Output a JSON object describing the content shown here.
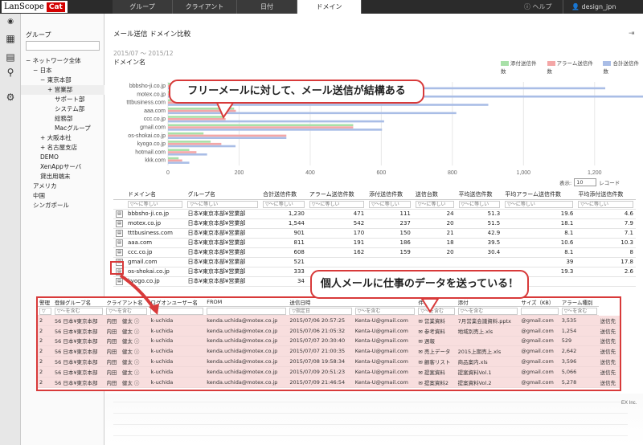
{
  "app": {
    "logo_text": "LanScope",
    "logo_badge": "Cat"
  },
  "tabs": [
    {
      "label": "グループ"
    },
    {
      "label": "クライアント"
    },
    {
      "label": "日付"
    },
    {
      "label": "ドメイン"
    }
  ],
  "header": {
    "help": "ヘルプ",
    "user": "design_jpn"
  },
  "sidebar": {
    "group_label": "グループ",
    "tree": [
      {
        "label": "ネットワーク全体",
        "prefix": "−",
        "indent": 0
      },
      {
        "label": "日本",
        "prefix": "−",
        "indent": 1
      },
      {
        "label": "東京本部",
        "prefix": "−",
        "indent": 2
      },
      {
        "label": "営業部",
        "prefix": "+",
        "indent": 3
      },
      {
        "label": "サポート部",
        "prefix": "",
        "indent": 4
      },
      {
        "label": "システム部",
        "prefix": "",
        "indent": 4
      },
      {
        "label": "総務部",
        "prefix": "",
        "indent": 4
      },
      {
        "label": "Macグループ",
        "prefix": "",
        "indent": 4
      },
      {
        "label": "大阪本社",
        "prefix": "+",
        "indent": 2
      },
      {
        "label": "名古屋支店",
        "prefix": "+",
        "indent": 2
      },
      {
        "label": "DEMO",
        "prefix": "",
        "indent": 2
      },
      {
        "label": "XenAppサーバ",
        "prefix": "",
        "indent": 2
      },
      {
        "label": "貸出用端末",
        "prefix": "",
        "indent": 2
      },
      {
        "label": "アメリカ",
        "prefix": "",
        "indent": 1
      },
      {
        "label": "中国",
        "prefix": "",
        "indent": 1
      },
      {
        "label": "シンガポール",
        "prefix": "",
        "indent": 1
      }
    ]
  },
  "main": {
    "title": "メール送信 ドメイン比較",
    "daterange": "2015/07 〜 2015/12",
    "domain_label": "ドメイン名",
    "pager_label": "表示:",
    "pager_value": "10",
    "pager_unit": "レコード"
  },
  "colors": {
    "attach": "#a8e0a8",
    "alarm": "#f4a7a7",
    "total": "#a9bde6",
    "callout": "#d83a3a"
  },
  "chart_data": {
    "type": "bar",
    "orientation": "horizontal",
    "categories": [
      "bbbsho-ji.co.jp",
      "motex.co.jp",
      "tttbusiness.com",
      "aaa.com",
      "ccc.co.jp",
      "gmail.com",
      "os-shokai.co.jp",
      "kyogo.co.jp",
      "hotmail.com",
      "kkk.com"
    ],
    "series": [
      {
        "name": "添付送信件数",
        "color": "#a8e0a8",
        "values": [
          111,
          237,
          150,
          186,
          159,
          521,
          100,
          120,
          60,
          30
        ]
      },
      {
        "name": "アラーム送信件数",
        "color": "#f4a7a7",
        "values": [
          471,
          542,
          170,
          191,
          162,
          521,
          333,
          150,
          80,
          40
        ]
      },
      {
        "name": "合計送信件数",
        "color": "#a9bde6",
        "values": [
          1230,
          1544,
          901,
          811,
          608,
          602,
          333,
          190,
          110,
          60
        ]
      }
    ],
    "xticks": [
      "0",
      "200",
      "400",
      "600",
      "800",
      "1,000",
      "1,200"
    ],
    "xlim": [
      0,
      1300
    ],
    "legend": "top-right"
  },
  "callouts": {
    "top": "フリーメールに対して、メール送信が結構ある",
    "bottom": "個人メールに仕事のデータを送っている！"
  },
  "table": {
    "headers": [
      "ドメイン名",
      "グループ名",
      "合計送信件数",
      "アラーム送信件数",
      "添付送信件数",
      "送信台数",
      "平均送信件数",
      "平均アラーム送信件数",
      "平均添付送信件数"
    ],
    "filter_placeholder": "▽〜に等しい",
    "rows": [
      [
        "bbbsho-ji.co.jp",
        "日本¥東京本部¥営業部",
        "1,230",
        "471",
        "111",
        "24",
        "51.3",
        "19.6",
        "4.6"
      ],
      [
        "motex.co.jp",
        "日本¥東京本部¥営業部",
        "1,544",
        "542",
        "237",
        "20",
        "51.5",
        "18.1",
        "7.9"
      ],
      [
        "tttbusiness.com",
        "日本¥東京本部¥営業部",
        "901",
        "170",
        "150",
        "21",
        "42.9",
        "8.1",
        "7.1"
      ],
      [
        "aaa.com",
        "日本¥東京本部¥営業部",
        "811",
        "191",
        "186",
        "18",
        "39.5",
        "10.6",
        "10.3"
      ],
      [
        "ccc.co.jp",
        "日本¥東京本部¥営業部",
        "608",
        "162",
        "159",
        "20",
        "30.4",
        "8.1",
        "8"
      ],
      [
        "gmail.com",
        "日本¥東京本部¥営業部",
        "521",
        "",
        "",
        "",
        "",
        "39",
        "17.8"
      ],
      [
        "os-shokai.co.jp",
        "日本¥東京本部¥営業部",
        "333",
        "",
        "",
        "",
        "",
        "19.3",
        "2.6"
      ],
      [
        "kyogo.co.jp",
        "日本¥東京本部¥営業部",
        "34",
        "",
        "",
        "",
        "",
        "",
        ""
      ]
    ]
  },
  "detail": {
    "headers": [
      "警理",
      "登録グループ名",
      "クライアント名",
      "ログオンユーザー名",
      "FROM",
      "送信日時",
      "",
      "件名",
      "添付",
      "サイズ（KB）",
      "アラーム種別"
    ],
    "filters": [
      "▽",
      "▽〜を含む",
      "▽〜を含む",
      "",
      "",
      "▽指定日",
      "▽〜を含む",
      "▽〜を含む",
      "▽〜を含む",
      "",
      "▽〜を含む"
    ],
    "rows": [
      [
        "2",
        "56 日本¥東京本部",
        "内田　健太",
        "k-uchida",
        "kenda.uchida@motex.co.jp",
        "2015/07/06 20:57:25",
        "Kenta-U@gmail.com",
        "営業資料",
        "7月営業会議資料.pptx",
        "@gmail.com",
        "3,535",
        "送信先"
      ],
      [
        "2",
        "56 日本¥東京本部",
        "内田　健太",
        "k-uchida",
        "kenda.uchida@motex.co.jp",
        "2015/07/06 21:05:32",
        "Kenta-U@gmail.com",
        "参考資料",
        "地域別売上.xls",
        "@gmail.com",
        "1,254",
        "送信先"
      ],
      [
        "2",
        "56 日本¥東京本部",
        "内田　健太",
        "k-uchida",
        "kenda.uchida@motex.co.jp",
        "2015/07/07 20:30:40",
        "Kenta-U@gmail.com",
        "週報",
        "",
        "@gmail.com",
        "529",
        "送信先"
      ],
      [
        "2",
        "56 日本¥東京本部",
        "内田　健太",
        "k-uchida",
        "kenda.uchida@motex.co.jp",
        "2015/07/07 21:00:35",
        "Kenta-U@gmail.com",
        "売上データ",
        "2015上期売上.xls",
        "@gmail.com",
        "2,642",
        "送信先"
      ],
      [
        "2",
        "56 日本¥東京本部",
        "内田　健太",
        "k-uchida",
        "kenda.uchida@motex.co.jp",
        "2015/07/08 19:58:34",
        "Kenta-U@gmail.com",
        "顧客リスト",
        "商品案内.xls",
        "@gmail.com",
        "3,596",
        "送信先"
      ],
      [
        "2",
        "56 日本¥東京本部",
        "内田　健太",
        "k-uchida",
        "kenda.uchida@motex.co.jp",
        "2015/07/09 20:51:23",
        "Kenta-U@gmail.com",
        "提案資料",
        "提案資料Vol.1",
        "@gmail.com",
        "5,066",
        "送信先"
      ],
      [
        "2",
        "56 日本¥東京本部",
        "内田　健太",
        "k-uchida",
        "kenda.uchida@motex.co.jp",
        "2015/07/09 21:46:54",
        "Kenta-U@gmail.com",
        "提案資料2",
        "提案資料Vol.2",
        "@gmail.com",
        "5,278",
        "送信先"
      ]
    ]
  },
  "footer_fragment": "EX Inc."
}
